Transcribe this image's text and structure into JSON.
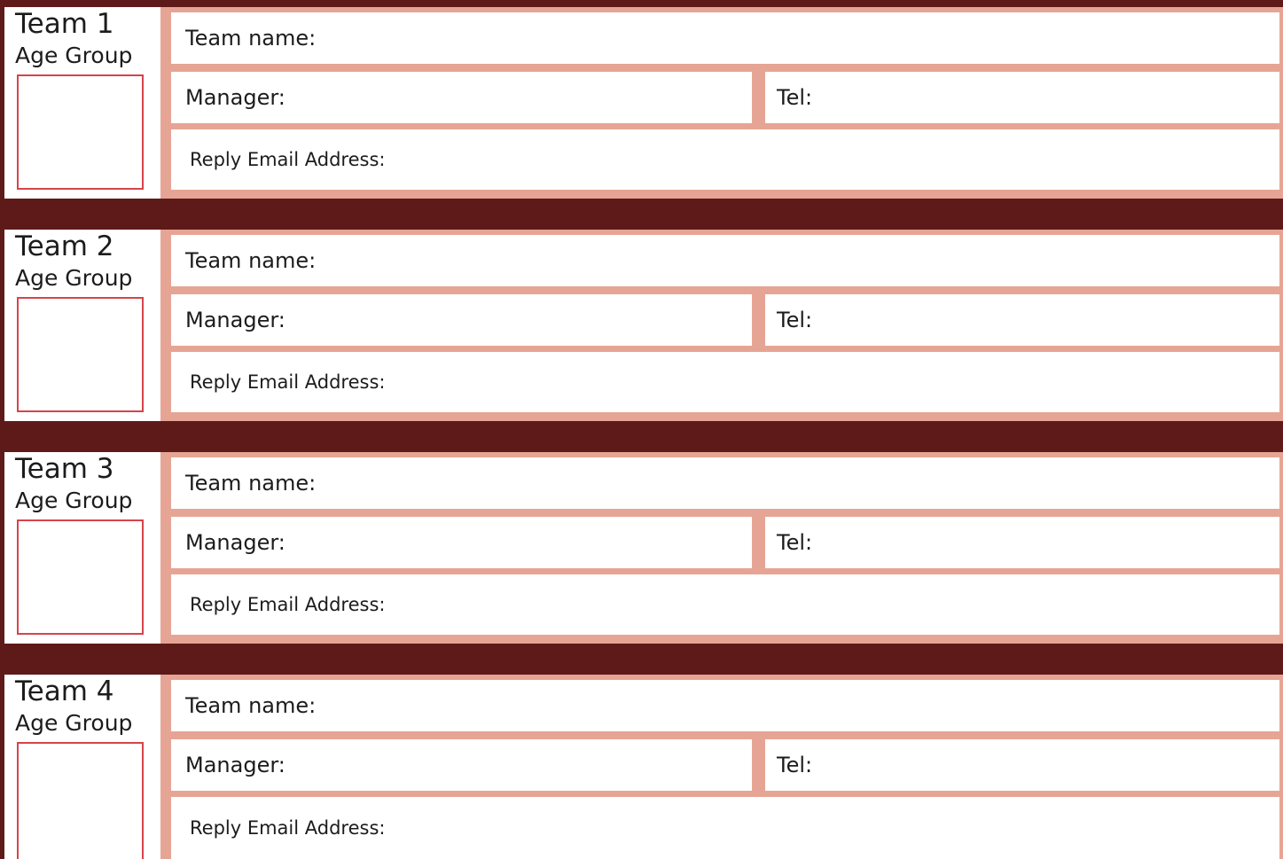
{
  "colors": {
    "background": "#5e1a19",
    "field_border": "#e6a594",
    "age_box_border": "#d6444a",
    "text": "#1c1c1c"
  },
  "teams": [
    {
      "title": "Team 1",
      "age_group_label": "Age Group",
      "team_name_label": "Team name:",
      "manager_label": "Manager:",
      "tel_label": "Tel:",
      "email_label": "Reply Email Address:"
    },
    {
      "title": "Team 2",
      "age_group_label": "Age Group",
      "team_name_label": "Team name:",
      "manager_label": "Manager:",
      "tel_label": "Tel:",
      "email_label": "Reply Email Address:"
    },
    {
      "title": "Team 3",
      "age_group_label": "Age Group",
      "team_name_label": "Team name:",
      "manager_label": "Manager:",
      "tel_label": "Tel:",
      "email_label": "Reply Email Address:"
    },
    {
      "title": "Team 4",
      "age_group_label": "Age Group",
      "team_name_label": "Team name:",
      "manager_label": "Manager:",
      "tel_label": "Tel:",
      "email_label": "Reply Email Address:"
    }
  ]
}
